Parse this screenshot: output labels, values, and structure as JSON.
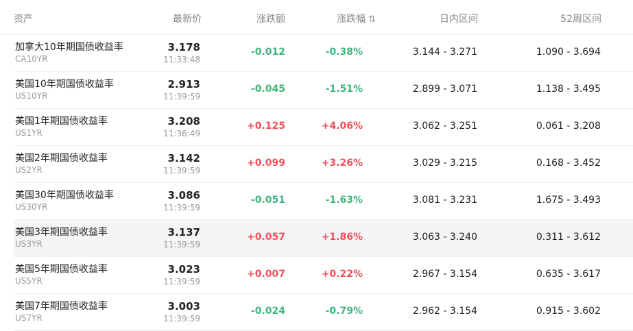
{
  "header": {
    "asset": "资产",
    "price": "最新价",
    "change": "涨跌额",
    "change_pct": "涨跌幅",
    "sort_glyph": "⇅",
    "day_range": "日内区间",
    "week52_range": "52周区间"
  },
  "colors": {
    "up": "#f0505a",
    "down": "#3fb47c",
    "row_highlight": "#f4f5f7"
  },
  "rows": [
    {
      "name": "加拿大10年期国债收益率",
      "code": "CA10YR",
      "price": "3.178",
      "time": "11:33:48",
      "change": "-0.012",
      "change_pct": "-0.38%",
      "direction": "down",
      "day_range": "3.144 - 3.271",
      "week52_range": "1.090 - 3.694"
    },
    {
      "name": "美国10年期国债收益率",
      "code": "US10YR",
      "price": "2.913",
      "time": "11:39:59",
      "change": "-0.045",
      "change_pct": "-1.51%",
      "direction": "down",
      "day_range": "2.899 - 3.071",
      "week52_range": "1.138 - 3.495"
    },
    {
      "name": "美国1年期国债收益率",
      "code": "US1YR",
      "price": "3.208",
      "time": "11:36:49",
      "change": "+0.125",
      "change_pct": "+4.06%",
      "direction": "up",
      "day_range": "3.062 - 3.251",
      "week52_range": "0.061 - 3.208"
    },
    {
      "name": "美国2年期国债收益率",
      "code": "US2YR",
      "price": "3.142",
      "time": "11:39:59",
      "change": "+0.099",
      "change_pct": "+3.26%",
      "direction": "up",
      "day_range": "3.029 - 3.215",
      "week52_range": "0.168 - 3.452"
    },
    {
      "name": "美国30年期国债收益率",
      "code": "US30YR",
      "price": "3.086",
      "time": "11:39:59",
      "change": "-0.051",
      "change_pct": "-1.63%",
      "direction": "down",
      "day_range": "3.081 - 3.231",
      "week52_range": "1.675 - 3.493"
    },
    {
      "name": "美国3年期国债收益率",
      "code": "US3YR",
      "price": "3.137",
      "time": "11:39:59",
      "change": "+0.057",
      "change_pct": "+1.86%",
      "direction": "up",
      "day_range": "3.063 - 3.240",
      "week52_range": "0.311 - 3.612"
    },
    {
      "name": "美国5年期国债收益率",
      "code": "US5YR",
      "price": "3.023",
      "time": "11:39:59",
      "change": "+0.007",
      "change_pct": "+0.22%",
      "direction": "up",
      "day_range": "2.967 - 3.154",
      "week52_range": "0.635 - 3.617"
    },
    {
      "name": "美国7年期国债收益率",
      "code": "US7YR",
      "price": "3.003",
      "time": "11:39:59",
      "change": "-0.024",
      "change_pct": "-0.79%",
      "direction": "down",
      "day_range": "2.962 - 3.154",
      "week52_range": "0.915 - 3.602"
    }
  ]
}
